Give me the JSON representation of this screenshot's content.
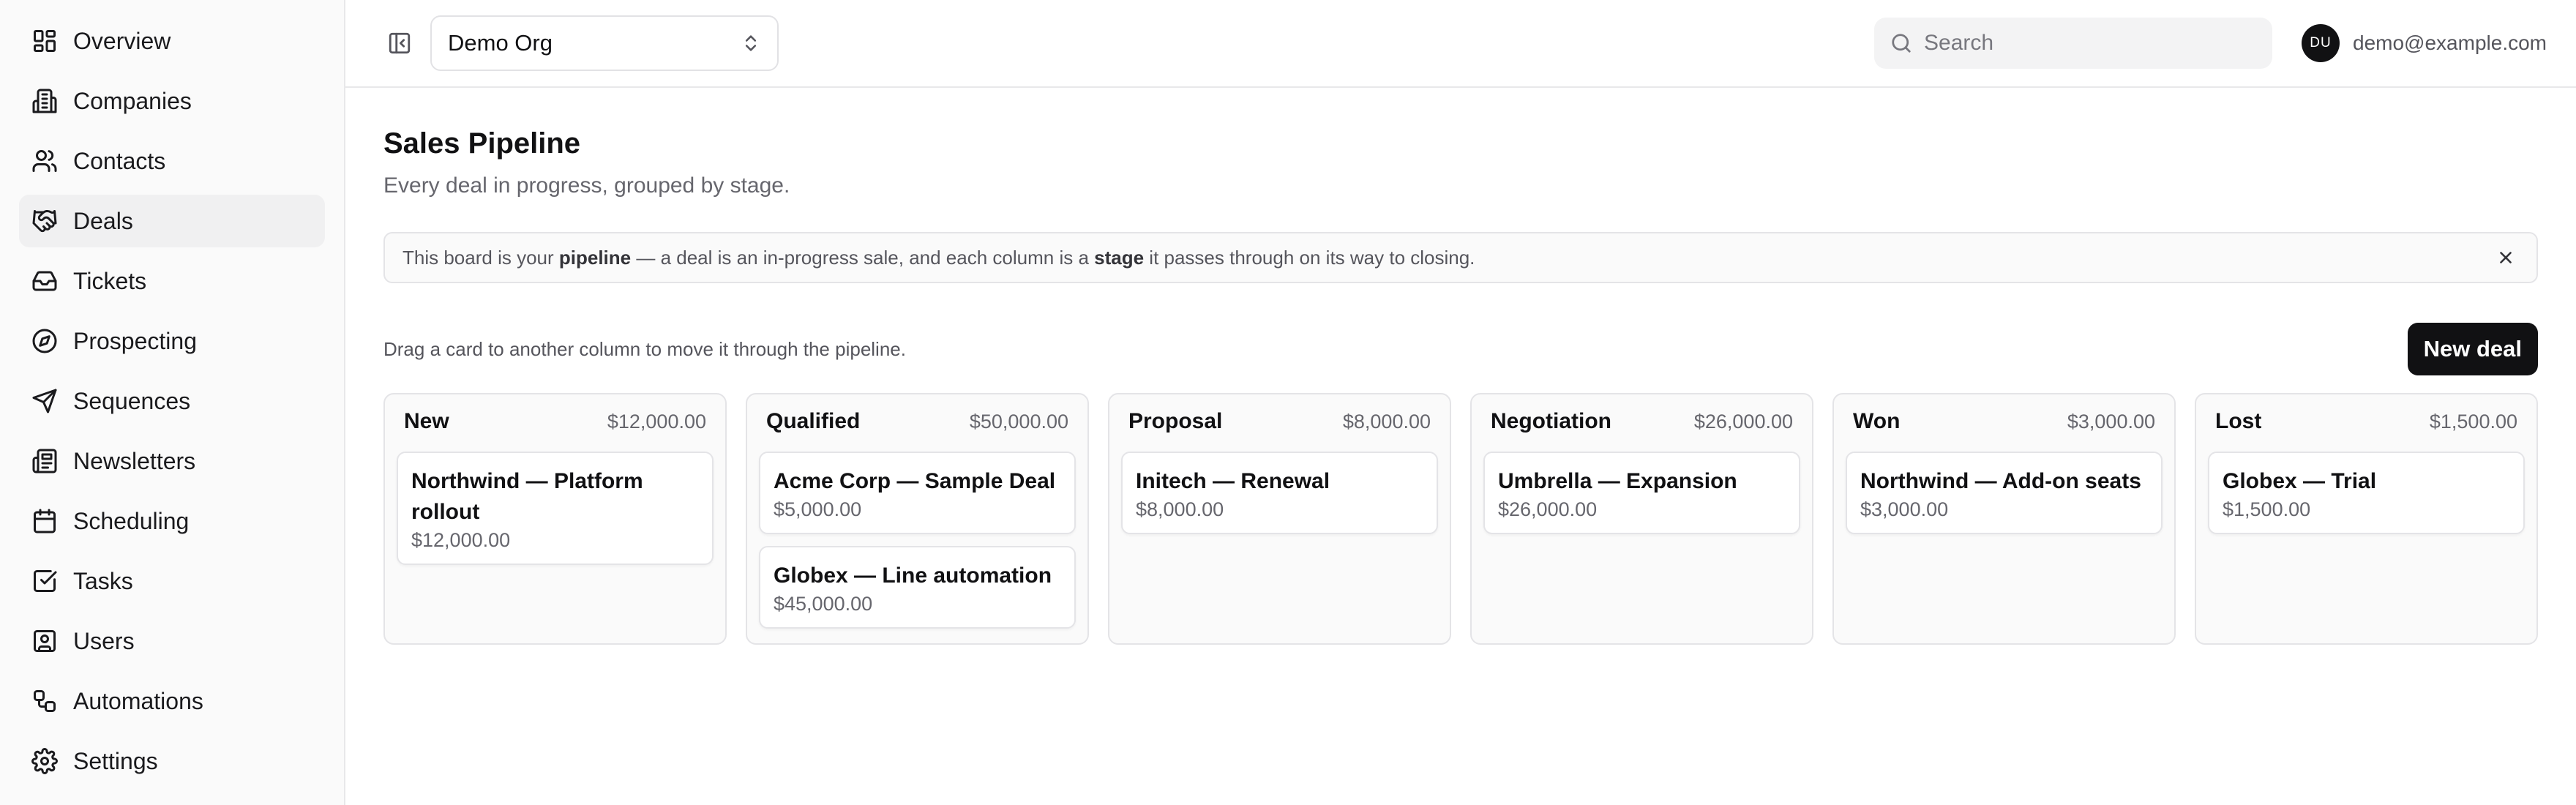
{
  "sidebar": {
    "items": [
      {
        "label": "Overview",
        "icon": "grid-icon",
        "active": false
      },
      {
        "label": "Companies",
        "icon": "building-icon",
        "active": false
      },
      {
        "label": "Contacts",
        "icon": "users-icon",
        "active": false
      },
      {
        "label": "Deals",
        "icon": "handshake-icon",
        "active": true
      },
      {
        "label": "Tickets",
        "icon": "inbox-icon",
        "active": false
      },
      {
        "label": "Prospecting",
        "icon": "compass-icon",
        "active": false
      },
      {
        "label": "Sequences",
        "icon": "send-icon",
        "active": false
      },
      {
        "label": "Newsletters",
        "icon": "newspaper-icon",
        "active": false
      },
      {
        "label": "Scheduling",
        "icon": "calendar-icon",
        "active": false
      },
      {
        "label": "Tasks",
        "icon": "checkbox-icon",
        "active": false
      },
      {
        "label": "Users",
        "icon": "user-square-icon",
        "active": false
      },
      {
        "label": "Automations",
        "icon": "workflow-icon",
        "active": false
      },
      {
        "label": "Settings",
        "icon": "gear-icon",
        "active": false
      }
    ]
  },
  "topbar": {
    "org_name": "Demo Org",
    "search_placeholder": "Search",
    "search_value": "",
    "avatar_initials": "DU",
    "user_email": "demo@example.com"
  },
  "page": {
    "title": "Sales Pipeline",
    "subtitle": "Every deal in progress, grouped by stage."
  },
  "banner": {
    "text_1": "This board is your ",
    "bold_1": "pipeline",
    "text_2": " — a deal is an in-progress sale, and each column is a ",
    "bold_2": "stage",
    "text_3": " it passes through on its way to closing."
  },
  "hint": "Drag a card to another column to move it through the pipeline.",
  "new_deal_label": "New deal",
  "columns": [
    {
      "name": "New",
      "total": "$12,000.00",
      "cards": [
        {
          "title": "Northwind — Platform rollout",
          "amount": "$12,000.00"
        }
      ]
    },
    {
      "name": "Qualified",
      "total": "$50,000.00",
      "cards": [
        {
          "title": "Acme Corp — Sample Deal",
          "amount": "$5,000.00"
        },
        {
          "title": "Globex — Line automation",
          "amount": "$45,000.00"
        }
      ]
    },
    {
      "name": "Proposal",
      "total": "$8,000.00",
      "cards": [
        {
          "title": "Initech — Renewal",
          "amount": "$8,000.00"
        }
      ]
    },
    {
      "name": "Negotiation",
      "total": "$26,000.00",
      "cards": [
        {
          "title": "Umbrella — Expansion",
          "amount": "$26,000.00"
        }
      ]
    },
    {
      "name": "Won",
      "total": "$3,000.00",
      "cards": [
        {
          "title": "Northwind — Add-on seats",
          "amount": "$3,000.00"
        }
      ]
    },
    {
      "name": "Lost",
      "total": "$1,500.00",
      "cards": [
        {
          "title": "Globex — Trial",
          "amount": "$1,500.00"
        }
      ]
    }
  ]
}
